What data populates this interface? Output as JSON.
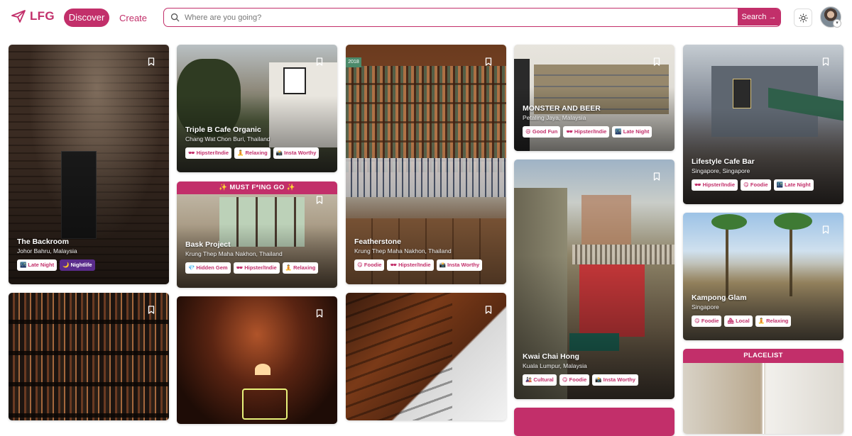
{
  "header": {
    "logo_text": "LFG",
    "nav": {
      "discover": "Discover",
      "create": "Create"
    },
    "search": {
      "placeholder": "Where are you going?",
      "button_label": "Search"
    }
  },
  "colors": {
    "brand": "#c22f6a",
    "nightlife_tag": "#5a2c8c"
  },
  "cards": [
    {
      "title": "The Backroom",
      "location": "Johor Bahru, Malaysia",
      "tags": [
        "🌃 Late Night",
        "🌙 Nightlife"
      ]
    },
    {
      "title": "Triple B Cafe Organic",
      "location": "Chang Wat Chon Buri, Thailand",
      "tags": [
        "🕶 Hipster/Indie",
        "🧘 Relaxing",
        "📸 Insta Worthy"
      ]
    },
    {
      "banner": "✨ MUST F*ING GO ✨",
      "title": "Bask Project",
      "location": "Krung Thep Maha Nakhon, Thailand",
      "tags": [
        "💎 Hidden Gem",
        "🕶 Hipster/Indie",
        "🧘 Relaxing"
      ]
    },
    {
      "badge": "2018",
      "title": "Featherstone",
      "location": "Krung Thep Maha Nakhon, Thailand",
      "tags": [
        "😋 Foodie",
        "🕶 Hipster/Indie",
        "📸 Insta Worthy"
      ]
    },
    {
      "title": "MONSTER AND BEER",
      "location": "Petaling Jaya, Malaysia",
      "tags": [
        "😄 Good Fun",
        "🕶 Hipster/Indie",
        "🌃 Late Night"
      ]
    },
    {
      "title": "Kwai Chai Hong",
      "location": "Kuala Lumpur, Malaysia",
      "tags": [
        "🎎 Cultural",
        "😋 Foodie",
        "📸 Insta Worthy"
      ]
    },
    {
      "title": "Lifestyle Cafe Bar",
      "location": "Singapore, Singapore",
      "tags": [
        "🕶 Hipster/Indie",
        "😋 Foodie",
        "🌃 Late Night"
      ]
    },
    {
      "title": "Kampong Glam",
      "location": "Singapore",
      "tags": [
        "😋 Foodie",
        "🏘 Local",
        "🧘 Relaxing"
      ]
    },
    {
      "banner": "PLACELIST"
    }
  ]
}
